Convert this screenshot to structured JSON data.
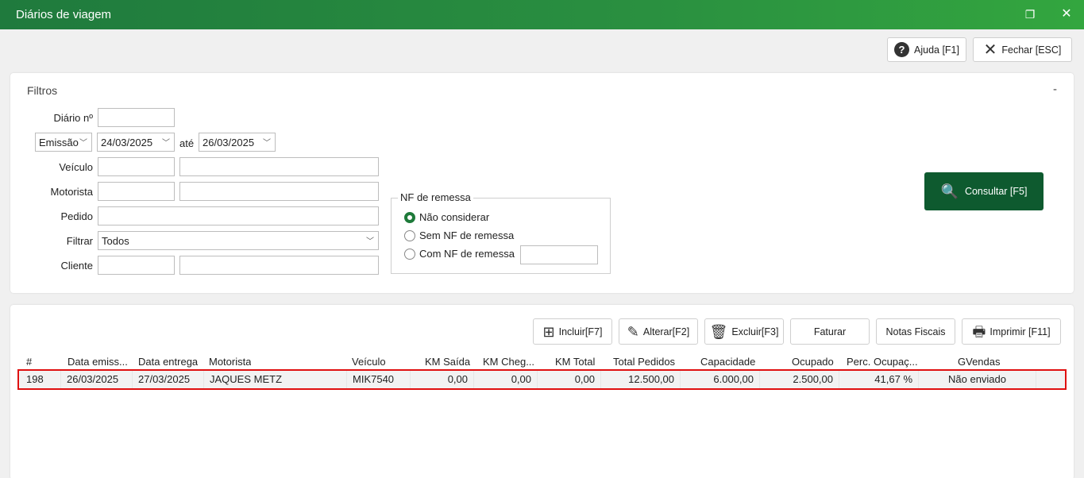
{
  "window": {
    "title": "Diários de viagem",
    "restore_glyph": "❐",
    "close_glyph": "✕"
  },
  "toolbar": {
    "help_label": "Ajuda [F1]",
    "help_glyph": "?",
    "close_label": "Fechar [ESC]",
    "close_glyph": "✕"
  },
  "filters": {
    "title": "Filtros",
    "collapse_glyph": "-",
    "diario_label": "Diário nº",
    "diario_value": "",
    "date_type": "Emissão",
    "date_from": "24/03/2025",
    "ate_label": "até",
    "date_to": "26/03/2025",
    "veiculo_label": "Veículo",
    "motorista_label": "Motorista",
    "pedido_label": "Pedido",
    "filtrar_label": "Filtrar",
    "filtrar_value": "Todos",
    "cliente_label": "Cliente",
    "nf": {
      "legend": "NF de remessa",
      "options": [
        "Não considerar",
        "Sem NF de remessa",
        "Com NF de remessa"
      ],
      "selected": "Não considerar"
    },
    "consultar_label": "Consultar [F5]",
    "consultar_glyph": "🔍"
  },
  "grid": {
    "buttons": {
      "incluir": "Incluir[F7]",
      "alterar": "Alterar[F2]",
      "excluir": "Excluir[F3]",
      "faturar": "Faturar",
      "notas": "Notas Fiscais",
      "imprimir": "Imprimir [F11]"
    },
    "icons": {
      "incluir": "⊞",
      "alterar": "✎",
      "excluir": "🗑",
      "imprimir": "🖶"
    },
    "columns": [
      "#",
      "Data emiss...",
      "Data entrega",
      "Motorista",
      "Veículo",
      "KM Saída",
      "KM Cheg...",
      "KM Total",
      "Total Pedidos",
      "Capacidade",
      "Ocupado",
      "Perc. Ocupaç...",
      "GVendas"
    ],
    "rows": [
      {
        "num": "198",
        "emissao": "26/03/2025",
        "entrega": "27/03/2025",
        "motorista": "JAQUES METZ",
        "veiculo": "MIK7540",
        "km_saida": "0,00",
        "km_chegada": "0,00",
        "km_total": "0,00",
        "total_pedidos": "12.500,00",
        "capacidade": "6.000,00",
        "ocupado": "2.500,00",
        "perc": "41,67 %",
        "gvendas": "Não enviado"
      }
    ]
  },
  "colors": {
    "title_bar": "#2a9040",
    "consultar_bg": "#0e5a2f",
    "radio_on": "#1e7a3a",
    "row_highlight": "#e01010"
  }
}
